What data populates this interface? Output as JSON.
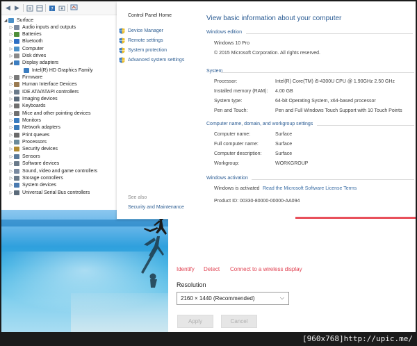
{
  "device_manager": {
    "root": "Surface",
    "items": [
      {
        "label": "Audio inputs and outputs",
        "icon": "speaker-icon",
        "color": "#7a8aa0"
      },
      {
        "label": "Batteries",
        "icon": "battery-icon",
        "color": "#4f8f3a"
      },
      {
        "label": "Bluetooth",
        "icon": "bluetooth-icon",
        "color": "#2d6fc4"
      },
      {
        "label": "Computer",
        "icon": "computer-icon",
        "color": "#4a90c8"
      },
      {
        "label": "Disk drives",
        "icon": "disk-icon",
        "color": "#8a8a8a"
      },
      {
        "label": "Display adapters",
        "icon": "monitor-icon",
        "color": "#3b7dc0"
      },
      {
        "label": "Intel(R) HD Graphics Family",
        "icon": "monitor-icon",
        "color": "#3b7dc0"
      },
      {
        "label": "Firmware",
        "icon": "chip-icon",
        "color": "#7a7a7a"
      },
      {
        "label": "Human Interface Devices",
        "icon": "hid-icon",
        "color": "#9a7a50"
      },
      {
        "label": "IDE ATA/ATAPI controllers",
        "icon": "controller-icon",
        "color": "#6a7a8a"
      },
      {
        "label": "Imaging devices",
        "icon": "camera-icon",
        "color": "#5a6a7a"
      },
      {
        "label": "Keyboards",
        "icon": "keyboard-icon",
        "color": "#707070"
      },
      {
        "label": "Mice and other pointing devices",
        "icon": "mouse-icon",
        "color": "#707070"
      },
      {
        "label": "Monitors",
        "icon": "monitor-icon",
        "color": "#3b7dc0"
      },
      {
        "label": "Network adapters",
        "icon": "network-icon",
        "color": "#3a7ab8"
      },
      {
        "label": "Print queues",
        "icon": "printer-icon",
        "color": "#6a6a6a"
      },
      {
        "label": "Processors",
        "icon": "cpu-icon",
        "color": "#6a8a9a"
      },
      {
        "label": "Security devices",
        "icon": "lock-icon",
        "color": "#b08a30"
      },
      {
        "label": "Sensors",
        "icon": "sensor-icon",
        "color": "#5a7a9a"
      },
      {
        "label": "Software devices",
        "icon": "software-icon",
        "color": "#6a7a8a"
      },
      {
        "label": "Sound, video and game controllers",
        "icon": "speaker-icon",
        "color": "#7a8aa0"
      },
      {
        "label": "Storage controllers",
        "icon": "storage-icon",
        "color": "#6a7a8a"
      },
      {
        "label": "System devices",
        "icon": "system-icon",
        "color": "#4a7ab0"
      },
      {
        "label": "Universal Serial Bus controllers",
        "icon": "usb-icon",
        "color": "#5a6a7a"
      }
    ]
  },
  "system": {
    "nav": {
      "home": "Control Panel Home",
      "links": [
        "Device Manager",
        "Remote settings",
        "System protection",
        "Advanced system settings"
      ],
      "see_also": "See also",
      "security_maintenance": "Security and Maintenance"
    },
    "title": "View basic information about your computer",
    "edition": {
      "heading": "Windows edition",
      "name": "Windows 10 Pro",
      "copyright": "© 2015 Microsoft Corporation. All rights reserved."
    },
    "system": {
      "heading": "System",
      "rows": [
        {
          "label": "Processor:",
          "value": "Intel(R) Core(TM) i5-4300U CPU @ 1.90GHz   2.50 GHz"
        },
        {
          "label": "Installed memory (RAM):",
          "value": "4.00 GB"
        },
        {
          "label": "System type:",
          "value": "64-bit Operating System, x64-based processor"
        },
        {
          "label": "Pen and Touch:",
          "value": "Pen and Full Windows Touch Support with 10 Touch Points"
        }
      ]
    },
    "computer_name": {
      "heading": "Computer name, domain, and workgroup settings",
      "rows": [
        {
          "label": "Computer name:",
          "value": "Surface"
        },
        {
          "label": "Full computer name:",
          "value": "Surface"
        },
        {
          "label": "Computer description:",
          "value": "Surface"
        },
        {
          "label": "Workgroup:",
          "value": "WORKGROUP"
        }
      ]
    },
    "activation": {
      "heading": "Windows activation",
      "status": "Windows is activated",
      "license_link": "Read the Microsoft Software License Terms",
      "product_id": "Product ID: 00330-80000-00000-AA094"
    }
  },
  "display": {
    "links": [
      "Identify",
      "Detect",
      "Connect to a wireless display"
    ],
    "resolution_label": "Resolution",
    "resolution_value": "2160 × 1440 (Recommended)",
    "apply_label": "Apply",
    "cancel_label": "Cancel"
  },
  "watermark": "[960x768]http://upic.me/",
  "colors": {
    "link_blue": "#2f5f93",
    "heading_blue": "#2a5b93",
    "accent_red": "#e04050"
  }
}
